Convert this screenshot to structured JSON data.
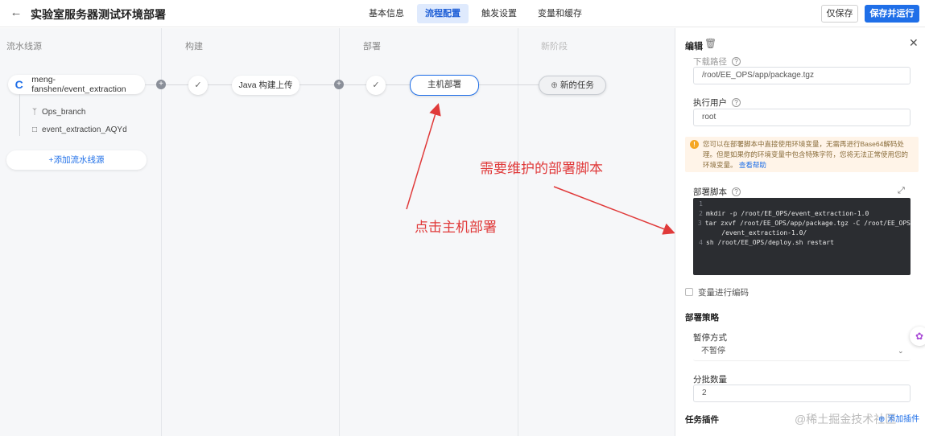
{
  "header": {
    "title": "实验室服务器测试环境部署",
    "tabs": [
      "基本信息",
      "流程配置",
      "触发设置",
      "变量和缓存"
    ],
    "active_tab": 1,
    "save_label": "仅保存",
    "save_run_label": "保存并运行"
  },
  "canvas": {
    "stages": [
      "流水线源",
      "构建",
      "部署",
      "新阶段"
    ],
    "source": {
      "name": "meng-fanshen/event_extraction",
      "branch": "Ops_branch",
      "alias": "event_extraction_AQYd",
      "add_label": "添加流水线源"
    },
    "jobs": {
      "build": "Java 构建上传",
      "deploy": "主机部署",
      "new_task": "新的任务"
    },
    "annotations": {
      "click": "点击主机部署",
      "script": "需要维护的部署脚本"
    }
  },
  "panel": {
    "title": "编辑",
    "package_path_label": "下载路径",
    "package_path_value": "/root/EE_OPS/app/package.tgz",
    "exec_user_label": "执行用户",
    "exec_user_value": "root",
    "warning_text": "您可以在部署脚本中直接使用环境变量，无需再进行Base64解码处理。但是如果你的环境变量中包含特殊字符，您将无法正常使用您的环境变量。",
    "warning_link": "查看帮助",
    "script_label": "部署脚本",
    "script_lines": [
      {
        "no": "1",
        "text": ""
      },
      {
        "no": "2",
        "text": "mkdir -p /root/EE_OPS/event_extraction-1.0"
      },
      {
        "no": "3",
        "text": "tar zxvf /root/EE_OPS/app/package.tgz -C /root/EE_OPS"
      },
      {
        "no": "",
        "text": "    /event_extraction-1.0/"
      },
      {
        "no": "4",
        "text": "sh /root/EE_OPS/deploy.sh restart"
      }
    ],
    "encode_label": "变量进行编码",
    "strategy_title": "部署策略",
    "pause_label": "暂停方式",
    "pause_value": "不暂停",
    "batch_label": "分批数量",
    "batch_value": "2",
    "plugins_title": "任务插件",
    "add_plugin_label": "添加插件",
    "watermark": "@稀土掘金技术社区"
  },
  "colors": {
    "accent": "#1f6fe8",
    "annotation": "#e03a3a",
    "warning_bg": "#fff4e8"
  }
}
